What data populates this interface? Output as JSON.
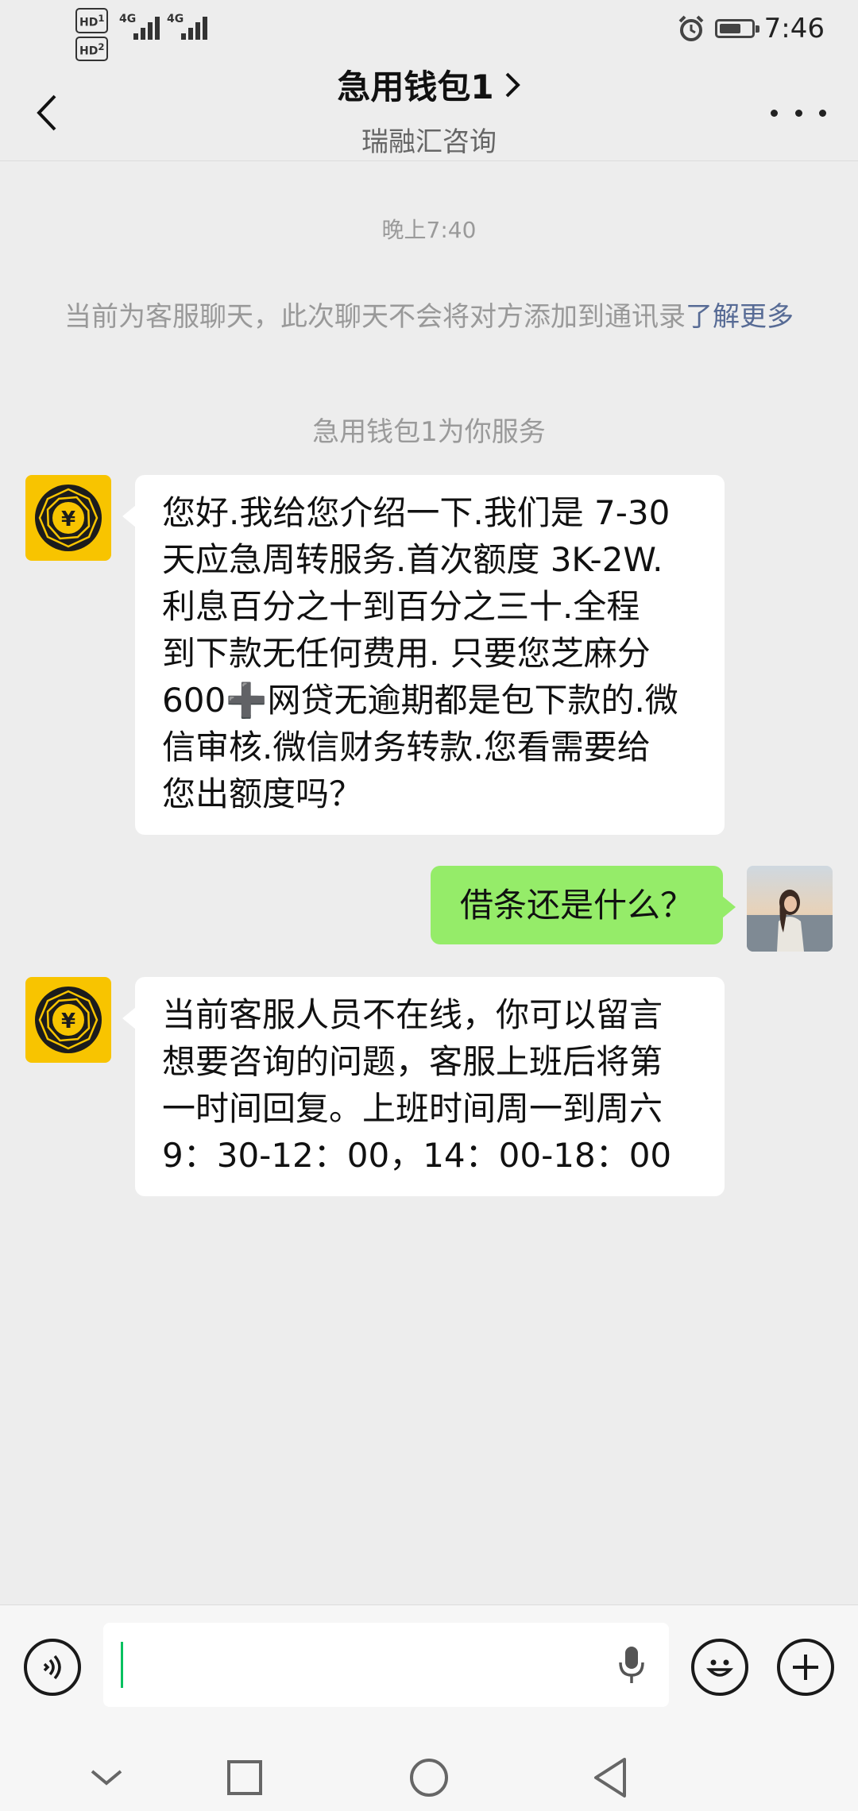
{
  "status_bar": {
    "hd_top": "HD",
    "hd_top_index": "1",
    "hd_bottom": "HD",
    "hd_bottom_index": "2",
    "signal1_label": "4G",
    "signal2_label": "4G",
    "time": "7:46",
    "battery_level": 0.7,
    "icons": [
      "alarm-icon",
      "battery-icon"
    ]
  },
  "header": {
    "title": "急用钱包1",
    "subtitle": "瑞融汇咨询",
    "icons": [
      "back-arrow-icon",
      "chevron-right-icon",
      "more-dots-icon"
    ]
  },
  "chat": {
    "timestamp": "晚上7:40",
    "notice_text": "当前为客服聊天，此次聊天不会将对方添加到通讯录",
    "notice_link": "了解更多",
    "service_notice": "急用钱包1为你服务",
    "messages": [
      {
        "sender": "bot",
        "lines": [
          "您好.我给您介绍一下.我们是 7-30",
          "天应急周转服务.首次额度 3K-2W.",
          "利息百分之十到百分之三十.全程",
          "到下款无任何费用. 只要您芝麻分",
          "600➕网贷无逾期都是包下款的.微",
          "信审核.微信财务转款.您看需要给",
          "您出额度吗？"
        ]
      },
      {
        "sender": "me",
        "text": "借条还是什么？"
      },
      {
        "sender": "bot",
        "lines": [
          "当前客服人员不在线，你可以留言",
          "想要咨询的问题，客服上班后将第",
          "一时间回复。上班时间周一到周六",
          "9：30-12：00，14：00-18：00"
        ]
      }
    ]
  },
  "input_bar": {
    "value": "",
    "icons": [
      "voice-icon",
      "microphone-icon",
      "emoji-icon",
      "plus-icon"
    ]
  },
  "nav_bar": {
    "icons": [
      "nav-collapse-icon",
      "nav-recent-icon",
      "nav-home-icon",
      "nav-back-icon"
    ]
  },
  "colors": {
    "background": "#ededed",
    "my_bubble": "#95ec69",
    "bot_bubble": "#ffffff",
    "bot_avatar": "#f8c400",
    "link": "#576b95",
    "caret": "#07c160"
  }
}
